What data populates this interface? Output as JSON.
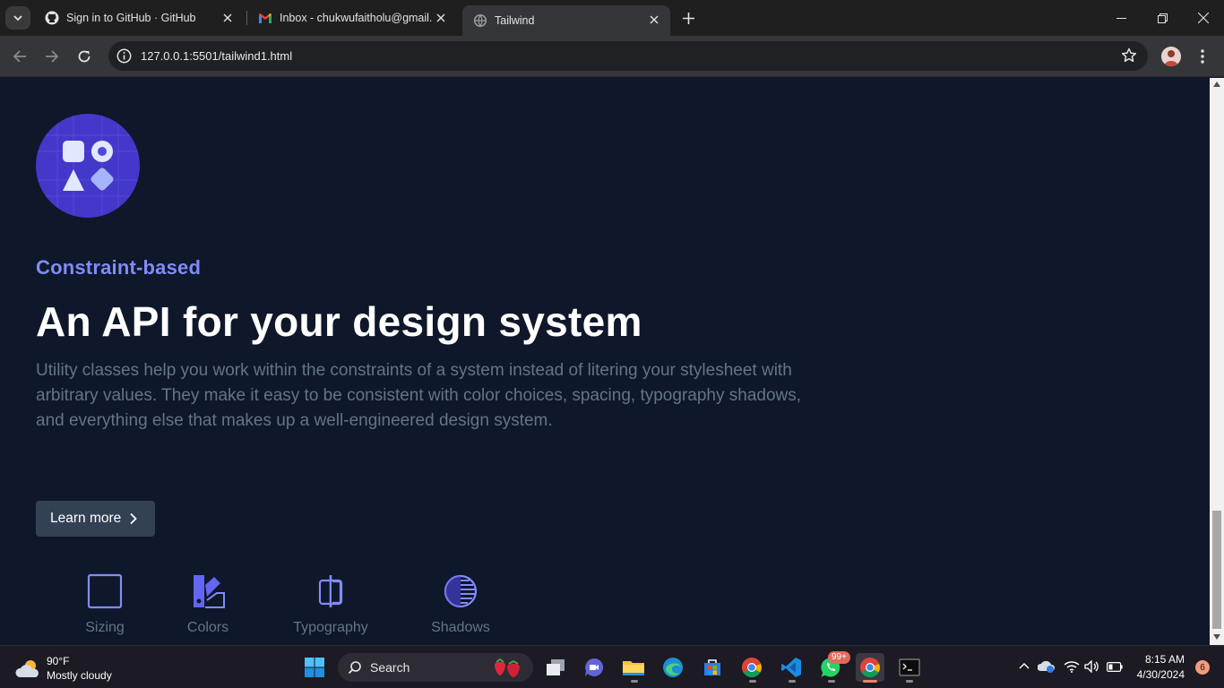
{
  "browser": {
    "tabs": [
      {
        "title": "Sign in to GitHub · GitHub",
        "icon": "github-icon",
        "active": false
      },
      {
        "title": "Inbox - chukwufaitholu@gmail.",
        "icon": "gmail-icon",
        "active": false
      },
      {
        "title": "Tailwind",
        "icon": "globe-icon",
        "active": true
      }
    ],
    "url": "127.0.0.1:5501/tailwind1.html"
  },
  "page": {
    "eyebrow": "Constraint-based",
    "headline": "An API for your design system",
    "description": "Utility classes help you work within the constraints of a system instead of litering your stylesheet with arbitrary values. They make it easy to be consistent with color choices, spacing, typography shadows, and everything else that makes up a well-engineered design system.",
    "learn_more": "Learn more",
    "features": [
      {
        "label": "Sizing",
        "icon": "square-icon"
      },
      {
        "label": "Colors",
        "icon": "swatch-icon"
      },
      {
        "label": "Typography",
        "icon": "typography-icon"
      },
      {
        "label": "Shadows",
        "icon": "shadow-icon"
      }
    ],
    "colors": {
      "background": "#0f172a",
      "accent": "#818cf8",
      "icon_bg": "#4338ca",
      "button_bg": "#334155",
      "muted": "#64748b"
    }
  },
  "taskbar": {
    "weather_temp": "90°F",
    "weather_desc": "Mostly cloudy",
    "search_label": "Search",
    "whatsapp_badge": "99+",
    "time": "8:15 AM",
    "date": "4/30/2024",
    "notifications": "6"
  }
}
